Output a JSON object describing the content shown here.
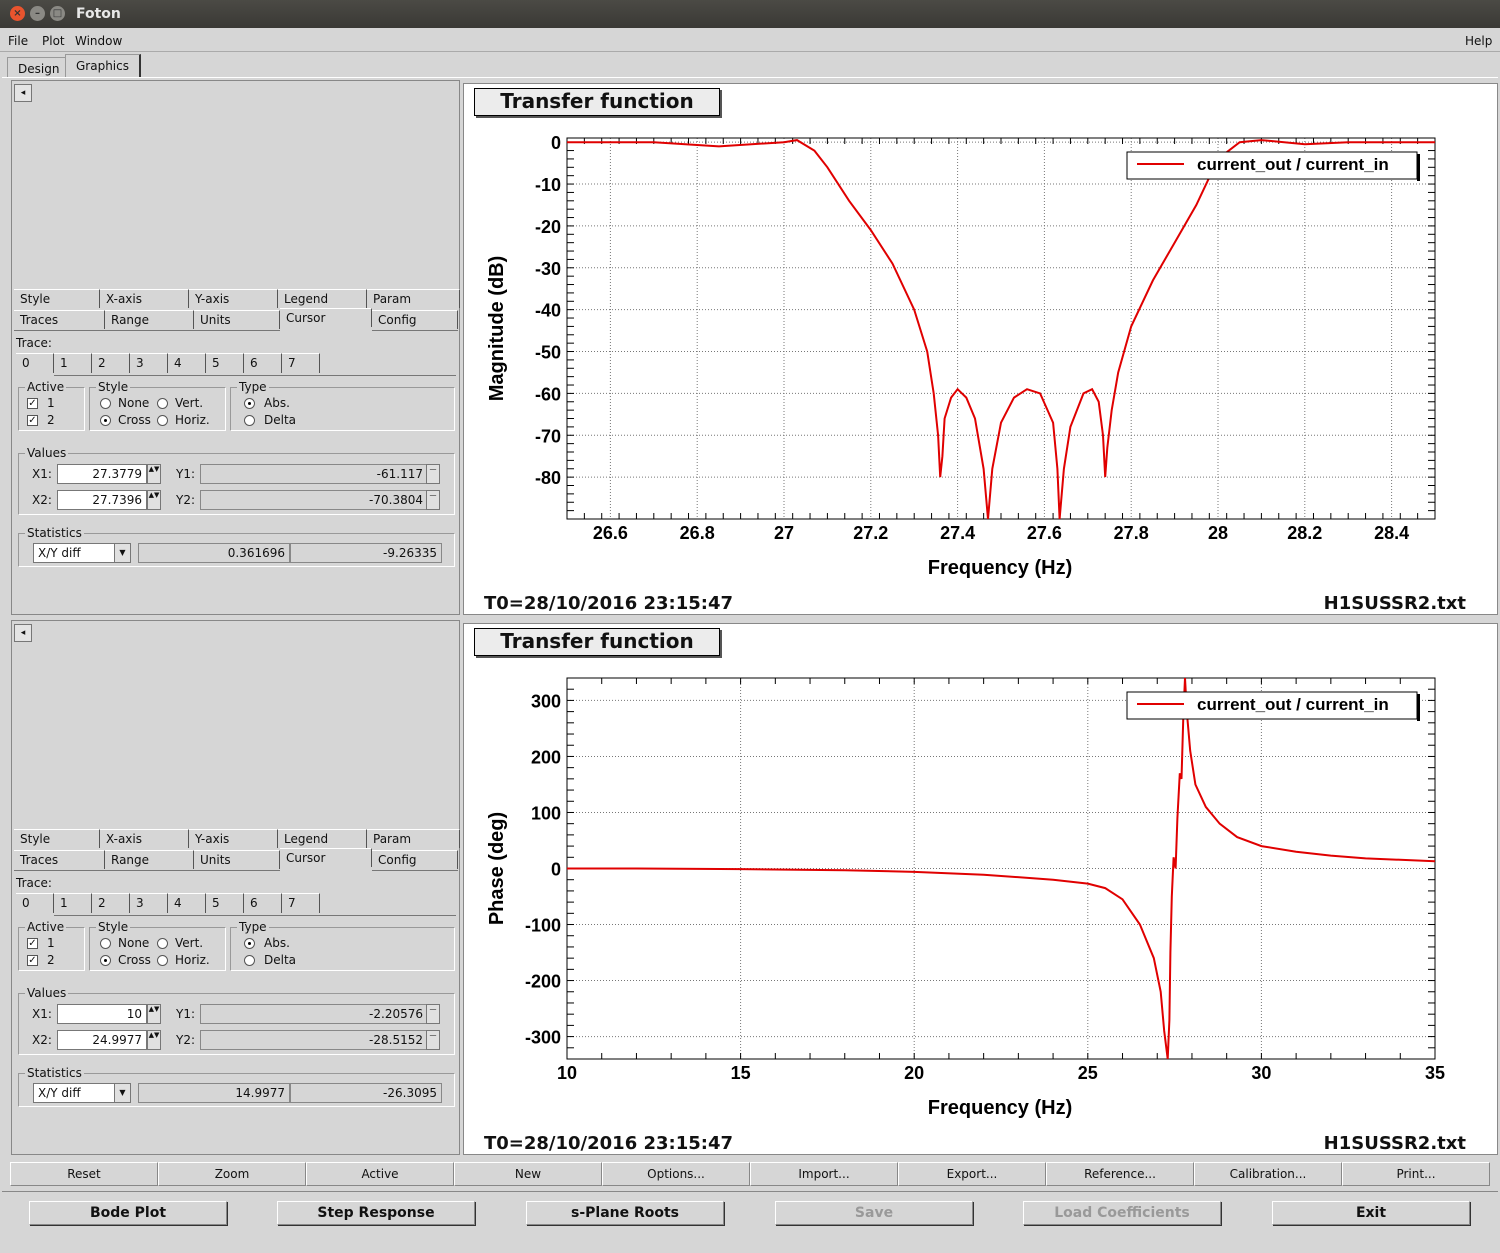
{
  "window": {
    "title": "Foton"
  },
  "menu": {
    "file": "File",
    "plot": "Plot",
    "window": "Window",
    "help": "Help"
  },
  "main_tabs": {
    "design": "Design",
    "graphics": "Graphics"
  },
  "panels": [
    {
      "tabs_row1": [
        "Style",
        "X-axis",
        "Y-axis",
        "Legend",
        "Param"
      ],
      "tabs_row2": [
        "Traces",
        "Range",
        "Units",
        "Cursor",
        "Config"
      ],
      "trace_label": "Trace:",
      "trace_tabs": [
        "0",
        "1",
        "2",
        "3",
        "4",
        "5",
        "6",
        "7"
      ],
      "active": {
        "title": "Active",
        "items": [
          "1",
          "2"
        ]
      },
      "style": {
        "title": "Style",
        "none": "None",
        "vert": "Vert.",
        "cross": "Cross",
        "horiz": "Horiz."
      },
      "type": {
        "title": "Type",
        "abs": "Abs.",
        "delta": "Delta"
      },
      "values": {
        "title": "Values",
        "x1_label": "X1:",
        "x2_label": "X2:",
        "y1_label": "Y1:",
        "y2_label": "Y2:",
        "x1": "27.3779",
        "x2": "27.7396",
        "y1": "-61.117",
        "y2": "-70.3804"
      },
      "statistics": {
        "title": "Statistics",
        "mode": "X/Y diff",
        "dx": "0.361696",
        "dy": "-9.26335"
      }
    },
    {
      "tabs_row1": [
        "Style",
        "X-axis",
        "Y-axis",
        "Legend",
        "Param"
      ],
      "tabs_row2": [
        "Traces",
        "Range",
        "Units",
        "Cursor",
        "Config"
      ],
      "trace_label": "Trace:",
      "trace_tabs": [
        "0",
        "1",
        "2",
        "3",
        "4",
        "5",
        "6",
        "7"
      ],
      "active": {
        "title": "Active",
        "items": [
          "1",
          "2"
        ]
      },
      "style": {
        "title": "Style",
        "none": "None",
        "vert": "Vert.",
        "cross": "Cross",
        "horiz": "Horiz."
      },
      "type": {
        "title": "Type",
        "abs": "Abs.",
        "delta": "Delta"
      },
      "values": {
        "title": "Values",
        "x1_label": "X1:",
        "x2_label": "X2:",
        "y1_label": "Y1:",
        "y2_label": "Y2:",
        "x1": "10",
        "x2": "24.9977",
        "y1": "-2.20576",
        "y2": "-28.5152"
      },
      "statistics": {
        "title": "Statistics",
        "mode": "X/Y diff",
        "dx": "14.9977",
        "dy": "-26.3095"
      }
    }
  ],
  "plots": [
    {
      "box_title": "Transfer function",
      "t0": "T0=28/10/2016 23:15:47",
      "file": "H1SUSSR2.txt"
    },
    {
      "box_title": "Transfer function",
      "t0": "T0=28/10/2016 23:15:47",
      "file": "H1SUSSR2.txt"
    }
  ],
  "chart_data": [
    {
      "type": "line",
      "title": "Transfer function",
      "xlabel": "Frequency (Hz)",
      "ylabel": "Magnitude (dB)",
      "xlim": [
        26.5,
        28.5
      ],
      "ylim": [
        -90,
        1
      ],
      "xticks": [
        "26.6",
        "26.8",
        "27",
        "27.2",
        "27.4",
        "27.6",
        "27.8",
        "28",
        "28.2",
        "28.4"
      ],
      "yticks": [
        "0",
        "-10",
        "-20",
        "-30",
        "-40",
        "-50",
        "-60",
        "-70",
        "-80"
      ],
      "legend": "current_out / current_in",
      "grid": true,
      "color": "#e00000",
      "series": [
        {
          "name": "current_out / current_in",
          "points": [
            [
              26.5,
              0
            ],
            [
              26.7,
              0
            ],
            [
              26.85,
              -1
            ],
            [
              27.0,
              0
            ],
            [
              27.03,
              0.5
            ],
            [
              27.07,
              -2
            ],
            [
              27.1,
              -6
            ],
            [
              27.15,
              -14
            ],
            [
              27.2,
              -21
            ],
            [
              27.25,
              -29
            ],
            [
              27.3,
              -40
            ],
            [
              27.33,
              -50
            ],
            [
              27.345,
              -60
            ],
            [
              27.355,
              -70
            ],
            [
              27.36,
              -80
            ],
            [
              27.365,
              -75
            ],
            [
              27.37,
              -66
            ],
            [
              27.385,
              -61
            ],
            [
              27.4,
              -59
            ],
            [
              27.42,
              -61
            ],
            [
              27.44,
              -66
            ],
            [
              27.46,
              -78
            ],
            [
              27.47,
              -90
            ],
            [
              27.48,
              -78
            ],
            [
              27.5,
              -67
            ],
            [
              27.53,
              -61
            ],
            [
              27.56,
              -59
            ],
            [
              27.59,
              -60
            ],
            [
              27.62,
              -67
            ],
            [
              27.63,
              -78
            ],
            [
              27.635,
              -90
            ],
            [
              27.645,
              -78
            ],
            [
              27.66,
              -68
            ],
            [
              27.69,
              -60
            ],
            [
              27.71,
              -59
            ],
            [
              27.725,
              -62
            ],
            [
              27.735,
              -70
            ],
            [
              27.74,
              -80
            ],
            [
              27.745,
              -73
            ],
            [
              27.755,
              -64
            ],
            [
              27.77,
              -55
            ],
            [
              27.8,
              -44
            ],
            [
              27.85,
              -33
            ],
            [
              27.9,
              -24
            ],
            [
              27.95,
              -15
            ],
            [
              28.0,
              -4
            ],
            [
              28.05,
              0
            ],
            [
              28.1,
              0.5
            ],
            [
              28.2,
              -0.5
            ],
            [
              28.3,
              0
            ],
            [
              28.5,
              0
            ]
          ]
        }
      ]
    },
    {
      "type": "line",
      "title": "Transfer function",
      "xlabel": "Frequency (Hz)",
      "ylabel": "Phase (deg)",
      "xlim": [
        10,
        35
      ],
      "ylim": [
        -340,
        340
      ],
      "xticks": [
        "10",
        "15",
        "20",
        "25",
        "30",
        "35"
      ],
      "yticks": [
        "300",
        "200",
        "100",
        "0",
        "-100",
        "-200",
        "-300"
      ],
      "legend": "current_out / current_in",
      "grid": true,
      "color": "#e00000",
      "series": [
        {
          "name": "current_out / current_in",
          "points": [
            [
              10,
              0
            ],
            [
              12,
              0
            ],
            [
              15,
              -1
            ],
            [
              18,
              -3
            ],
            [
              20,
              -6
            ],
            [
              22,
              -11
            ],
            [
              24,
              -20
            ],
            [
              25,
              -27
            ],
            [
              25.5,
              -35
            ],
            [
              26,
              -55
            ],
            [
              26.5,
              -100
            ],
            [
              26.9,
              -160
            ],
            [
              27.1,
              -220
            ],
            [
              27.2,
              -290
            ],
            [
              27.3,
              -340
            ],
            [
              27.35,
              -270
            ],
            [
              27.38,
              -150
            ],
            [
              27.42,
              -50
            ],
            [
              27.47,
              20
            ],
            [
              27.53,
              0
            ],
            [
              27.58,
              90
            ],
            [
              27.65,
              170
            ],
            [
              27.7,
              160
            ],
            [
              27.75,
              270
            ],
            [
              27.8,
              340
            ],
            [
              27.85,
              280
            ],
            [
              27.95,
              210
            ],
            [
              28.1,
              150
            ],
            [
              28.4,
              110
            ],
            [
              28.8,
              80
            ],
            [
              29.3,
              56
            ],
            [
              30,
              40
            ],
            [
              31,
              30
            ],
            [
              32,
              23
            ],
            [
              33,
              18
            ],
            [
              35,
              13
            ]
          ]
        }
      ]
    }
  ],
  "toolbar": [
    "Reset",
    "Zoom",
    "Active",
    "New",
    "Options...",
    "Import...",
    "Export...",
    "Reference...",
    "Calibration...",
    "Print..."
  ],
  "bottom_buttons": [
    {
      "label": "Bode Plot",
      "enabled": true
    },
    {
      "label": "Step Response",
      "enabled": true
    },
    {
      "label": "s-Plane Roots",
      "enabled": true
    },
    {
      "label": "Save",
      "enabled": false
    },
    {
      "label": "Load Coefficients",
      "enabled": false
    },
    {
      "label": "Exit",
      "enabled": true
    }
  ]
}
